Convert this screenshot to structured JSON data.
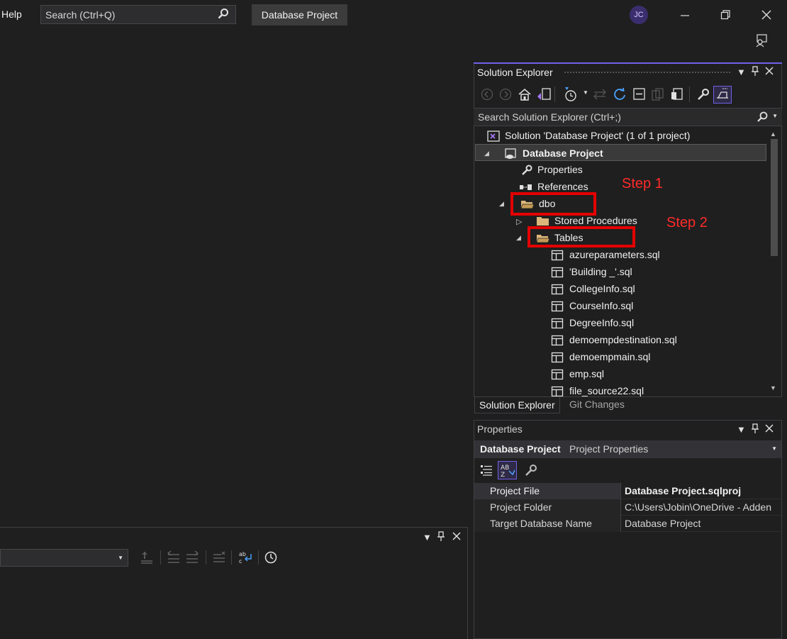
{
  "menu": {
    "help": "Help"
  },
  "search": {
    "placeholder": "Search (Ctrl+Q)"
  },
  "project_button": "Database Project",
  "user": {
    "initials": "JC"
  },
  "solution_explorer": {
    "title": "Solution Explorer",
    "search_placeholder": "Search Solution Explorer (Ctrl+;)",
    "tree": {
      "solution": "Solution 'Database Project' (1 of 1 project)",
      "project": "Database Project",
      "properties": "Properties",
      "references": "References",
      "dbo": "dbo",
      "stored_procedures": "Stored Procedures",
      "tables": "Tables",
      "files": [
        "azureparameters.sql",
        "'Building _'.sql",
        "CollegeInfo.sql",
        "CourseInfo.sql",
        "DegreeInfo.sql",
        "demoempdestination.sql",
        "demoempmain.sql",
        "emp.sql",
        "file_source22.sql"
      ]
    },
    "tabs": [
      "Solution Explorer",
      "Git Changes"
    ]
  },
  "annotations": {
    "step1": "Step 1",
    "step2": "Step 2"
  },
  "properties_panel": {
    "title": "Properties",
    "object_name": "Database Project",
    "object_type": "Project Properties",
    "rows": [
      {
        "key": "Project File",
        "value": "Database Project.sqlproj"
      },
      {
        "key": "Project Folder",
        "value": "C:\\Users\\Jobin\\OneDrive - Adden"
      },
      {
        "key": "Target Database Name",
        "value": "Database Project"
      }
    ]
  },
  "colors": {
    "accent": "#7160e8",
    "annotation_red": "#e50000",
    "folder": "#dcb67a"
  }
}
